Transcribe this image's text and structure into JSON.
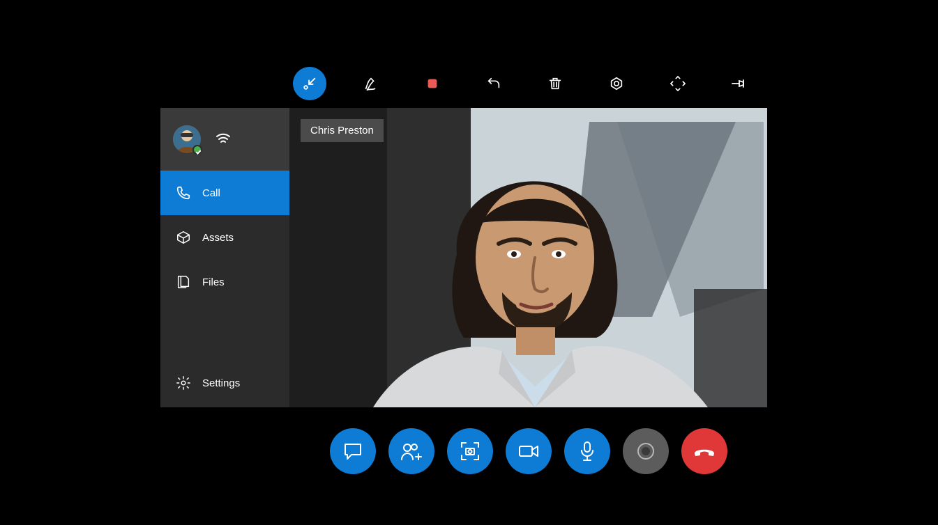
{
  "colors": {
    "accent": "#0E7BD4",
    "hangup": "#E03838",
    "sidebar_bg": "#2B2B2B",
    "header_bg": "#3A3A3A"
  },
  "top_toolbar": {
    "items": [
      {
        "name": "minimize-to-corner-icon",
        "active": true
      },
      {
        "name": "pen-icon"
      },
      {
        "name": "record-stop-icon"
      },
      {
        "name": "undo-icon"
      },
      {
        "name": "delete-icon"
      },
      {
        "name": "aperture-icon"
      },
      {
        "name": "expand-icon"
      },
      {
        "name": "pin-icon"
      }
    ]
  },
  "sidebar": {
    "items": [
      {
        "icon": "phone-icon",
        "label": "Call",
        "active": true
      },
      {
        "icon": "assets-icon",
        "label": "Assets"
      },
      {
        "icon": "files-icon",
        "label": "Files"
      }
    ],
    "settings": {
      "icon": "gear-icon",
      "label": "Settings"
    }
  },
  "video": {
    "participant_name": "Chris Preston"
  },
  "dock": {
    "items": [
      {
        "name": "chat-button",
        "style": "blue",
        "icon": "chat-icon"
      },
      {
        "name": "add-participant-button",
        "style": "blue",
        "icon": "add-people-icon"
      },
      {
        "name": "snapshot-button",
        "style": "blue",
        "icon": "capture-icon"
      },
      {
        "name": "video-toggle-button",
        "style": "blue",
        "icon": "video-icon"
      },
      {
        "name": "mic-toggle-button",
        "style": "blue",
        "icon": "mic-icon"
      },
      {
        "name": "record-button",
        "style": "gray",
        "icon": "record-icon"
      },
      {
        "name": "hangup-button",
        "style": "red",
        "icon": "hangup-icon"
      }
    ]
  }
}
